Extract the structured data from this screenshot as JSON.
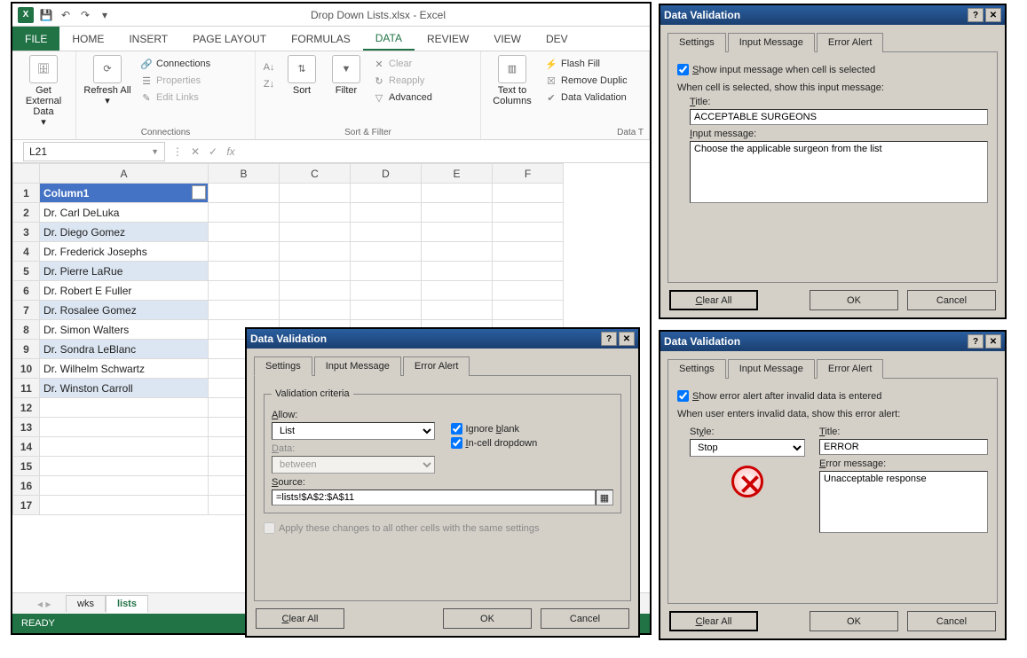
{
  "app": {
    "window_title": "Drop Down Lists.xlsx - Excel",
    "status": "READY",
    "name_box": "L21",
    "formula": ""
  },
  "qat_icons": [
    "excel",
    "save",
    "undo",
    "redo"
  ],
  "tabs": {
    "file": "FILE",
    "items": [
      "HOME",
      "INSERT",
      "PAGE LAYOUT",
      "FORMULAS",
      "DATA",
      "REVIEW",
      "VIEW",
      "DEV"
    ],
    "active": "DATA"
  },
  "ribbon": {
    "get_external": "Get External Data",
    "refresh": "Refresh All",
    "connections": "Connections",
    "conn_items": [
      "Connections",
      "Properties",
      "Edit Links"
    ],
    "sort": "Sort",
    "filter": "Filter",
    "filter_items": [
      "Clear",
      "Reapply",
      "Advanced"
    ],
    "sort_filter": "Sort & Filter",
    "text_cols": "Text to Columns",
    "datatools": [
      "Flash Fill",
      "Remove Duplic",
      "Data Validation"
    ],
    "data_tools_label": "Data T"
  },
  "columns": [
    "A",
    "B",
    "C",
    "D",
    "E",
    "F"
  ],
  "header_cell": "Column1",
  "rows": [
    "Dr. Carl DeLuka",
    "Dr. Diego Gomez",
    "Dr. Frederick Josephs",
    "Dr. Pierre LaRue",
    "Dr. Robert E Fuller",
    "Dr. Rosalee Gomez",
    "Dr. Simon Walters",
    "Dr. Sondra LeBlanc",
    "Dr. Wilhelm Schwartz",
    "Dr. Winston Carroll"
  ],
  "sheet_tabs": {
    "items": [
      "wks",
      "lists"
    ],
    "active": "lists"
  },
  "dlg": {
    "title": "Data Validation",
    "tabs": [
      "Settings",
      "Input Message",
      "Error Alert"
    ],
    "clear_all": "Clear All",
    "ok": "OK",
    "cancel": "Cancel"
  },
  "settings": {
    "legend": "Validation criteria",
    "allow_lbl": "Allow:",
    "allow_val": "List",
    "data_lbl": "Data:",
    "data_val": "between",
    "source_lbl": "Source:",
    "source_val": "=lists!$A$2:$A$11",
    "ignore_blank": "Ignore blank",
    "incell": "In-cell dropdown",
    "apply_all": "Apply these changes to all other cells with the same settings",
    "ignore_checked": true,
    "incell_checked": true,
    "apply_checked": false
  },
  "inputmsg": {
    "show_lbl": "Show input message when cell is selected",
    "show_checked": true,
    "when_lbl": "When cell is selected, show this input message:",
    "title_lbl": "Title:",
    "title_val": "ACCEPTABLE SURGEONS",
    "msg_lbl": "Input message:",
    "msg_val": "Choose the applicable surgeon from the list"
  },
  "erroralert": {
    "show_lbl": "Show error alert after invalid data is entered",
    "show_checked": true,
    "when_lbl": "When user enters invalid data, show this error alert:",
    "style_lbl": "Style:",
    "style_val": "Stop",
    "title_lbl": "Title:",
    "title_val": "ERROR",
    "msg_lbl": "Error message:",
    "msg_val": "Unacceptable response"
  }
}
